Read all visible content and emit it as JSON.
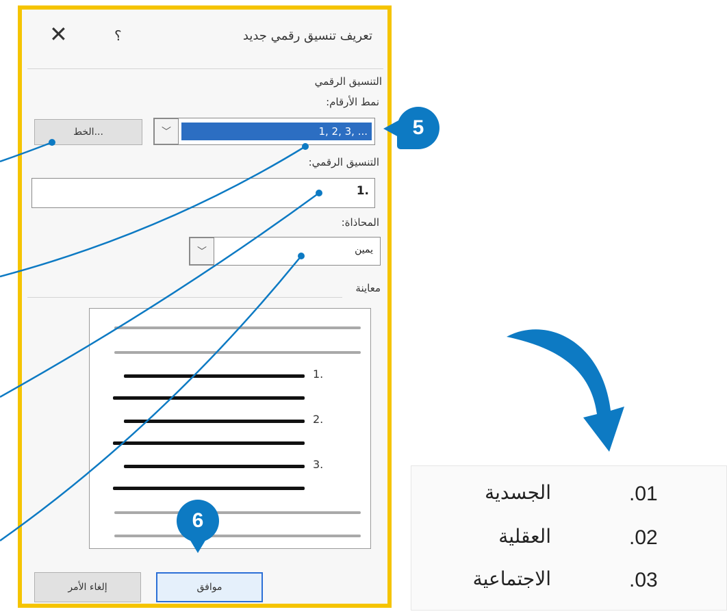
{
  "dialog": {
    "title": "تعريف تنسيق رقمي جديد",
    "help_glyph": "؟",
    "close_glyph": "✕",
    "section_label": "التنسيق الرقمي",
    "number_style_label": "نمط الأرقام:",
    "number_style_value": "1, 2, 3, ...",
    "font_button_label": "الخط...",
    "number_format_label": "التنسيق الرقمي:",
    "number_format_value": "1.",
    "alignment_label": "المحاذاة:",
    "alignment_value": "يمين",
    "preview_label": "معاينة",
    "preview_numbers": [
      "1.",
      "2.",
      "3."
    ],
    "ok_label": "موافق",
    "cancel_label": "إلغاء الأمر"
  },
  "callouts": {
    "step5": "5",
    "step6": "6"
  },
  "result_list": [
    {
      "num": ".01",
      "text": "الجسدية"
    },
    {
      "num": ".02",
      "text": "العقلية"
    },
    {
      "num": ".03",
      "text": "الاجتماعية"
    }
  ],
  "colors": {
    "frame": "#f5c400",
    "callout": "#0d7ac3",
    "selection": "#2c6ec2",
    "ok_border": "#2b6fd6"
  }
}
